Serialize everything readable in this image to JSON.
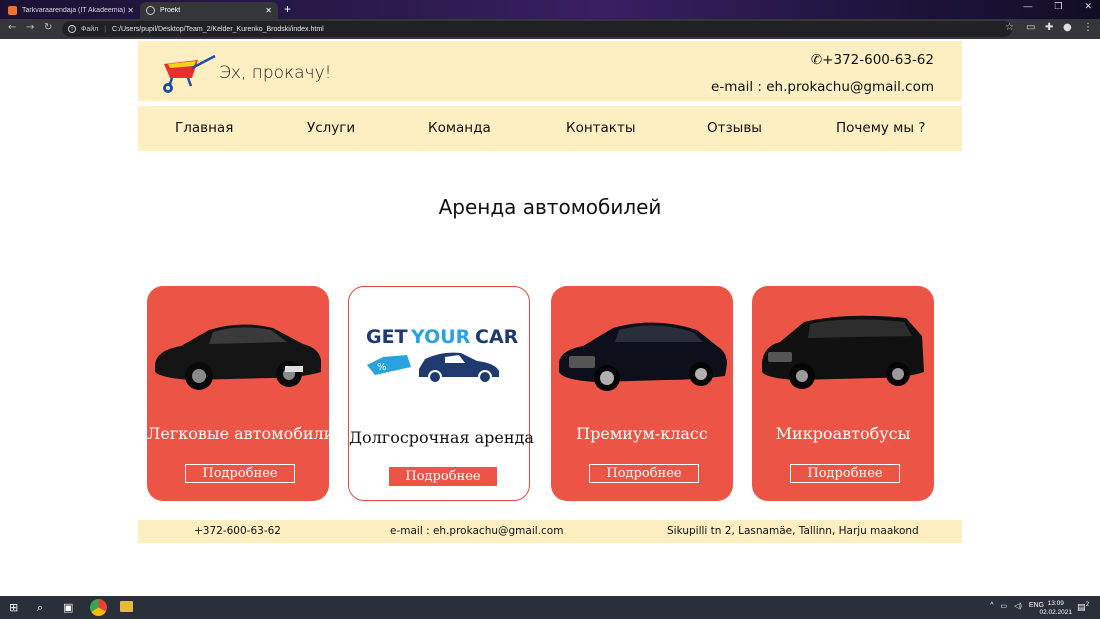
{
  "browser": {
    "tabs": [
      {
        "title": "Tarkvaraarendaja (IT Akadeemia)",
        "close": "✕"
      },
      {
        "title": "Proekt",
        "close": "✕"
      }
    ],
    "new_tab": "+",
    "url_label": "Файл",
    "url_separator": "|",
    "url": "C:/Users/pupil/Desktop/Team_2/Kelder_Kurenko_Brodski/index.html"
  },
  "header": {
    "brand": "Эх, прокачу!",
    "phone": "✆+372-600-63-62",
    "email": "e-mail : eh.prokachu@gmail.com"
  },
  "menu": [
    "Главная",
    "Услуги",
    "Команда",
    "Контакты",
    "Отзывы",
    "Почему мы ?"
  ],
  "heading": "Аренда автомобилей",
  "cards": [
    {
      "title": "Легковые автомобили",
      "button": "Подробнее"
    },
    {
      "title": "Долгосрочная аренда",
      "button": "Подробнее",
      "logo_text_1": "GET",
      "logo_text_2": "YOUR",
      "logo_text_3": "CAR",
      "tag": "%"
    },
    {
      "title": "Премиум-класс",
      "button": "Подробнее"
    },
    {
      "title": "Микроавтобусы",
      "button": "Подробнее"
    }
  ],
  "footer": {
    "phone": "+372-600-63-62",
    "email": "e-mail : eh.prokachu@gmail.com",
    "address": "Sikupilli tn 2, Lasnamäe, Tallinn, Harju maakond"
  },
  "taskbar": {
    "lang": "ENG",
    "time": "13:09",
    "date": "02.02.2021",
    "notifications": "2"
  },
  "colors": {
    "accent": "#ec5545",
    "header_bg": "#fdefc2",
    "logo_blue": "#1f3a6e",
    "logo_lightblue": "#29a3e0"
  }
}
